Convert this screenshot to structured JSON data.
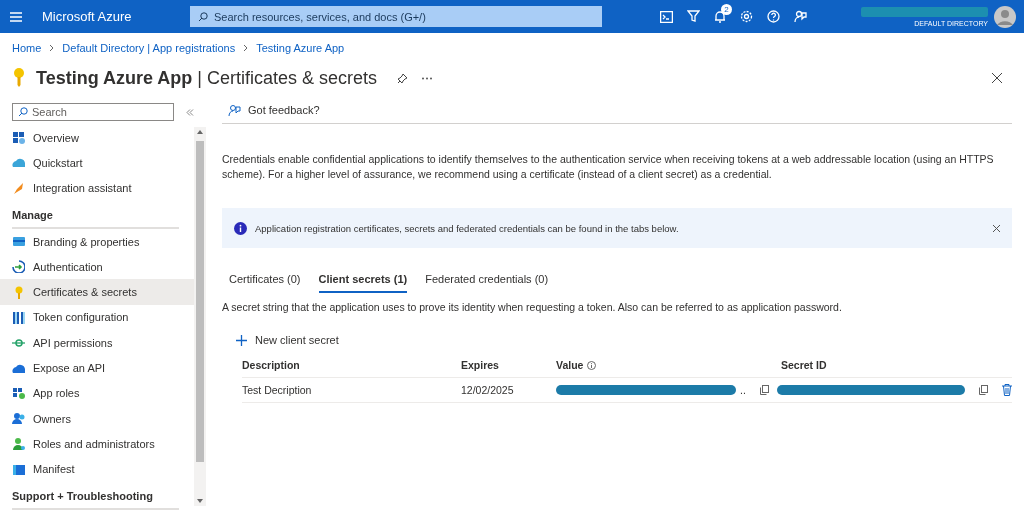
{
  "top_bar": {
    "brand": "Microsoft Azure",
    "search": {
      "placeholder": "Search resources, services, and docs (G+/)"
    },
    "notification_count": "2",
    "directory": "DEFAULT DIRECTORY"
  },
  "breadcrumb": [
    "Home",
    "Default Directory | App registrations",
    "Testing Azure App"
  ],
  "page": {
    "title": "Testing Azure App",
    "separator": "|",
    "subtitle": "Certificates & secrets"
  },
  "sidebar": {
    "search": {
      "placeholder": "Search"
    },
    "groups": [
      {
        "items": [
          {
            "label": "Overview",
            "selected": false
          },
          {
            "label": "Quickstart",
            "selected": false
          },
          {
            "label": "Integration assistant",
            "selected": false
          }
        ]
      },
      {
        "heading": "Manage",
        "items": [
          {
            "label": "Branding & properties",
            "selected": false
          },
          {
            "label": "Authentication",
            "selected": false
          },
          {
            "label": "Certificates & secrets",
            "selected": true
          },
          {
            "label": "Token configuration",
            "selected": false
          },
          {
            "label": "API permissions",
            "selected": false
          },
          {
            "label": "Expose an API",
            "selected": false
          },
          {
            "label": "App roles",
            "selected": false
          },
          {
            "label": "Owners",
            "selected": false
          },
          {
            "label": "Roles and administrators",
            "selected": false
          },
          {
            "label": "Manifest",
            "selected": false
          }
        ]
      },
      {
        "heading": "Support + Troubleshooting"
      }
    ]
  },
  "feedback": "Got feedback?",
  "description": "Credentials enable confidential applications to identify themselves to the authentication service when receiving tokens at a web addressable location (using an HTTPS scheme). For a higher level of assurance, we recommend using a certificate (instead of a client secret) as a credential.",
  "info_banner": "Application registration certificates, secrets and federated credentials can be found in the tabs below.",
  "tabs": [
    {
      "label": "Certificates (0)",
      "selected": false
    },
    {
      "label": "Client secrets (1)",
      "selected": true
    },
    {
      "label": "Federated credentials (0)",
      "selected": false
    }
  ],
  "tab_description": "A secret string that the application uses to prove its identity when requesting a token. Also can be referred to as application password.",
  "new_button": "New client secret",
  "table": {
    "columns": [
      "Description",
      "Expires",
      "Value",
      "Secret ID"
    ],
    "rows": [
      {
        "description": "Test Decription",
        "expires": "12/02/2025",
        "value_suffix": ".."
      }
    ]
  }
}
